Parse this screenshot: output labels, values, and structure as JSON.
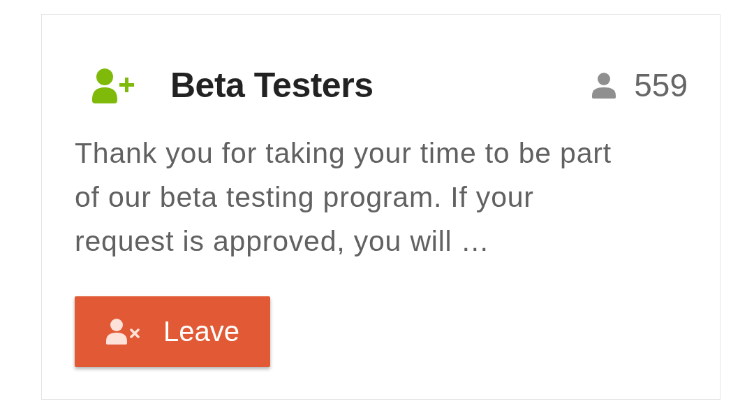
{
  "group": {
    "title": "Beta Testers",
    "member_count": "559",
    "description": "Thank you for taking your time to be part of our beta testing program. If your request is approved, you will …",
    "leave_button": {
      "label": "Leave"
    }
  }
}
